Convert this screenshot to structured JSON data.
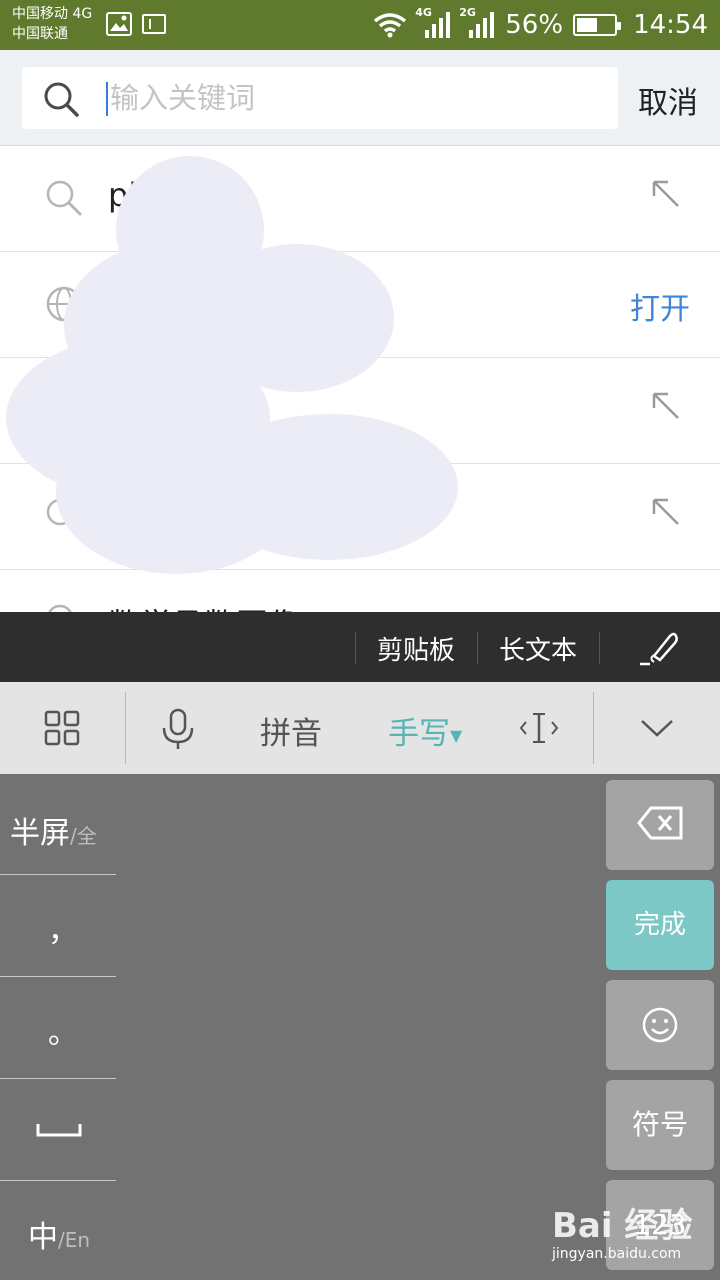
{
  "status_bar": {
    "carrier_1": "中国移动 4G",
    "carrier_2": "中国联通",
    "signal_1_label": "4G",
    "signal_2_label": "2G",
    "battery_percent": "56%",
    "battery_level": 0.56,
    "time": "14:54",
    "icons": [
      "image-icon",
      "sim-icon",
      "wifi-icon",
      "signal-icon",
      "battery-icon"
    ]
  },
  "search": {
    "placeholder": "输入关键词",
    "value": "",
    "cancel_label": "取消"
  },
  "suggestions": [
    {
      "text": "pi",
      "icon": "search-icon",
      "action_icon": "fill-arrow-icon"
    },
    {
      "text": "",
      "icon": "globe-icon",
      "action_label": "打开"
    },
    {
      "text": "",
      "icon": "search-icon",
      "action_icon": "fill-arrow-icon"
    },
    {
      "text": "",
      "icon": "search-icon",
      "action_icon": "fill-arrow-icon"
    },
    {
      "text": "数学函数图像",
      "icon": "search-icon",
      "action_icon": "fill-arrow-icon"
    }
  ],
  "ime_toolbar": {
    "clipboard": "剪贴板",
    "long_text": "长文本"
  },
  "keyboard_toolbar": {
    "pinyin": "拼音",
    "handwriting": "手写",
    "accent_color": "#57b6b5"
  },
  "keyboard": {
    "half_screen": "半屏",
    "full_screen": "/全",
    "comma": "，",
    "period": "。",
    "lang_zh": "中",
    "lang_en": "/En",
    "done": "完成",
    "symbols": "符号",
    "numbers": "123"
  },
  "watermark": {
    "brand": "Bai 经验",
    "url": "jingyan.baidu.com"
  }
}
